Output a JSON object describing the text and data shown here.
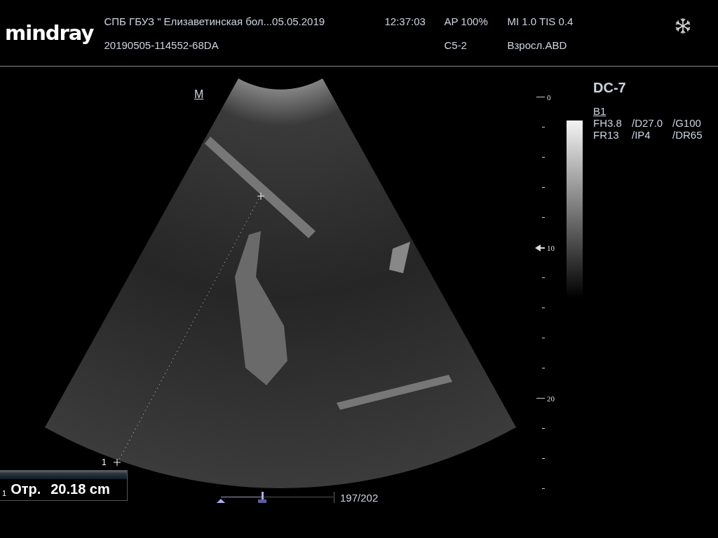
{
  "header": {
    "logo": "mindray",
    "row_1": [
      "СПБ  ГБУЗ \" Елизаветинская бол...",
      "05.05.2019",
      "12:37:03",
      "AP  100%",
      "MI 1.0 TIS 0.4"
    ],
    "row_2": [
      "20190505-114552-68DA",
      "C5-2",
      "Взросл.ABD"
    ]
  },
  "image": {
    "orientation_mark": "M",
    "caliper_label": "1"
  },
  "measurement": {
    "index": "1",
    "label": "Отр.",
    "value": "20.18 cm"
  },
  "cine": {
    "level": 0.37,
    "frames": "197/202"
  },
  "depth_scale": {
    "ticks": [
      {
        "kind": "major",
        "label": "0",
        "focus": false
      },
      {
        "kind": "minor"
      },
      {
        "kind": "minor"
      },
      {
        "kind": "minor"
      },
      {
        "kind": "minor"
      },
      {
        "kind": "major",
        "label": "10",
        "focus": true
      },
      {
        "kind": "minor"
      },
      {
        "kind": "minor"
      },
      {
        "kind": "minor"
      },
      {
        "kind": "minor"
      },
      {
        "kind": "major",
        "label": "20",
        "focus": false
      },
      {
        "kind": "minor"
      },
      {
        "kind": "minor"
      },
      {
        "kind": "minor"
      }
    ]
  },
  "params": {
    "probe": "DC-7",
    "mode": "B1",
    "rows": [
      [
        "FH3.8",
        "/D27.0",
        "/G100"
      ],
      [
        "FR13",
        "/IP4",
        "/DR65"
      ]
    ]
  }
}
